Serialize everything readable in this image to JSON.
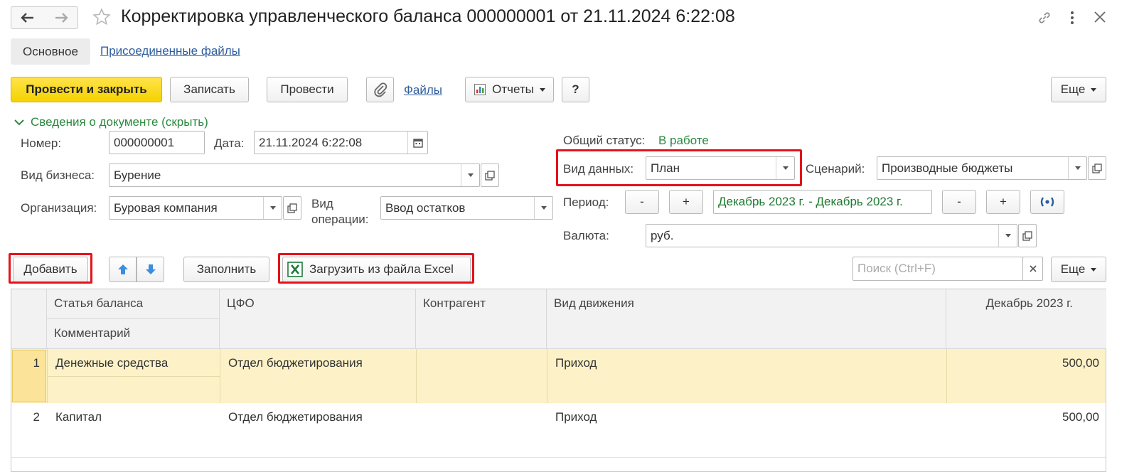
{
  "window": {
    "title": "Корректировка управленческого баланса 000000001 от 21.11.2024 6:22:08"
  },
  "tabs": {
    "main": "Основное",
    "files": "Присоединенные файлы"
  },
  "toolbar": {
    "post_close": "Провести и закрыть",
    "save": "Записать",
    "post": "Провести",
    "files_link": "Файлы",
    "reports": "Отчеты",
    "help": "?",
    "more": "Еще"
  },
  "section": {
    "toggle": "Сведения о документе (скрыть)"
  },
  "form": {
    "number_label": "Номер:",
    "number_value": "000000001",
    "date_label": "Дата:",
    "date_value": "21.11.2024  6:22:08",
    "business_label": "Вид бизнеса:",
    "business_value": "Бурение",
    "org_label": "Организация:",
    "org_value": "Буровая компания",
    "operation_label_1": "Вид",
    "operation_label_2": "операции:",
    "operation_value": "Ввод остатков",
    "status_label": "Общий статус:",
    "status_value": "В работе",
    "datatype_label": "Вид данных:",
    "datatype_value": "План",
    "scenario_label": "Сценарий:",
    "scenario_value": "Производные бюджеты",
    "period_label": "Период:",
    "period_minus": "-",
    "period_plus": "+",
    "period_value": "Декабрь 2023 г. - Декабрь 2023 г.",
    "currency_label": "Валюта:",
    "currency_value": "руб."
  },
  "table_toolbar": {
    "add": "Добавить",
    "fill": "Заполнить",
    "load_excel": "Загрузить из файла Excel",
    "search_placeholder": "Поиск (Ctrl+F)",
    "more": "Еще"
  },
  "table": {
    "columns": {
      "article": "Статья баланса",
      "comment": "Комментарий",
      "cfo": "ЦФО",
      "counterparty": "Контрагент",
      "movement": "Вид движения",
      "period": "Декабрь 2023 г."
    },
    "rows": [
      {
        "n": "1",
        "article": "Денежные средства",
        "cfo": "Отдел бюджетирования",
        "counterparty": "",
        "movement": "Приход",
        "amount": "500,00"
      },
      {
        "n": "2",
        "article": "Капитал",
        "cfo": "Отдел бюджетирования",
        "counterparty": "",
        "movement": "Приход",
        "amount": "500,00"
      }
    ]
  },
  "colors": {
    "primary_button": "#f5d200",
    "highlight": "#e5121a",
    "status_green": "#2a8a3e",
    "selected_row": "#fdf2c7"
  }
}
